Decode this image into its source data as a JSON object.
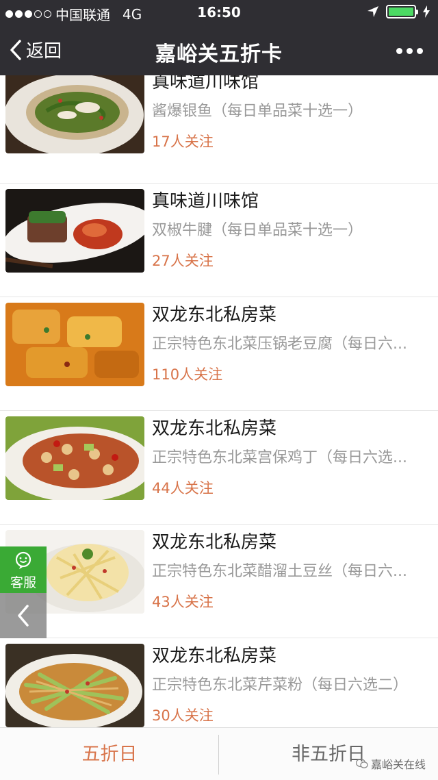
{
  "status_bar": {
    "carrier": "中国联通",
    "network": "4G",
    "time": "16:50"
  },
  "nav": {
    "back_label": "返回",
    "title": "嘉峪关五折卡"
  },
  "items": [
    {
      "name": "真味道川味馆",
      "desc": "酱爆银鱼（每日单品菜十选一）",
      "follow": "17人关注"
    },
    {
      "name": "真味道川味馆",
      "desc": "双椒牛腱（每日单品菜十选一）",
      "follow": "27人关注"
    },
    {
      "name": "双龙东北私房菜",
      "desc": "正宗特色东北菜压锅老豆腐（每日六...",
      "follow": "110人关注"
    },
    {
      "name": "双龙东北私房菜",
      "desc": "正宗特色东北菜宫保鸡丁（每日六选...",
      "follow": "44人关注"
    },
    {
      "name": "双龙东北私房菜",
      "desc": "正宗特色东北菜醋溜土豆丝（每日六...",
      "follow": "43人关注"
    },
    {
      "name": "双龙东北私房菜",
      "desc": "正宗特色东北菜芹菜粉（每日六选二）",
      "follow": "30人关注"
    }
  ],
  "float": {
    "service_label": "客服"
  },
  "bottom": {
    "tab_left": "五折日",
    "tab_right": "非五折日",
    "watermark": "嘉峪关在线"
  },
  "colors": {
    "accent": "#d8744a",
    "bar": "#2f2e33",
    "service": "#3aaa35"
  }
}
